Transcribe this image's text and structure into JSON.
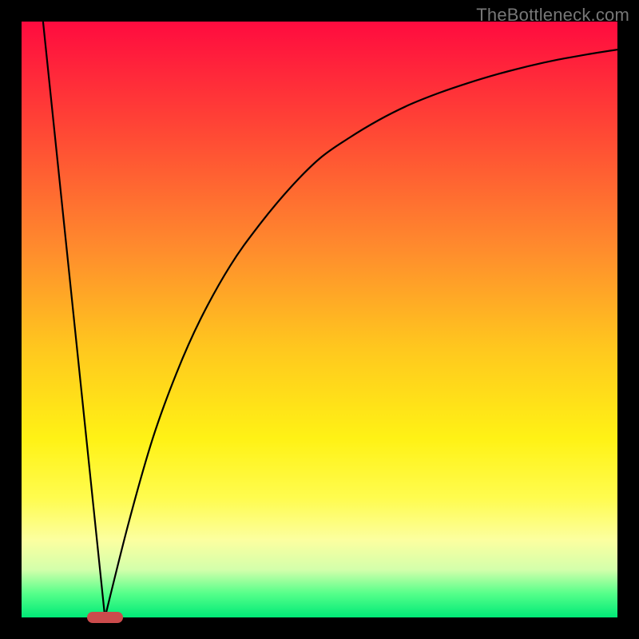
{
  "watermark": {
    "text": "TheBottleneck.com"
  },
  "colors": {
    "frame": "#000000",
    "curve": "#000000",
    "marker": "#cc4b4c",
    "gradient_top": "#ff0b3f",
    "gradient_bottom": "#00e977"
  },
  "chart_data": {
    "type": "line",
    "title": "",
    "xlabel": "",
    "ylabel": "",
    "xlim": [
      0,
      100
    ],
    "ylim": [
      0,
      100
    ],
    "grid": false,
    "legend": false,
    "marker": {
      "x": 14,
      "y": 0,
      "width": 6
    },
    "series": [
      {
        "name": "left-line",
        "x": [
          3.6,
          14
        ],
        "values": [
          100,
          0
        ]
      },
      {
        "name": "right-curve",
        "x": [
          14,
          18,
          22,
          26,
          30,
          35,
          40,
          45,
          50,
          55,
          60,
          65,
          70,
          75,
          80,
          85,
          90,
          95,
          100
        ],
        "values": [
          0,
          16,
          30,
          41,
          50,
          59,
          66,
          72,
          77,
          80.5,
          83.5,
          86,
          88,
          89.7,
          91.2,
          92.5,
          93.6,
          94.5,
          95.3
        ]
      }
    ]
  }
}
